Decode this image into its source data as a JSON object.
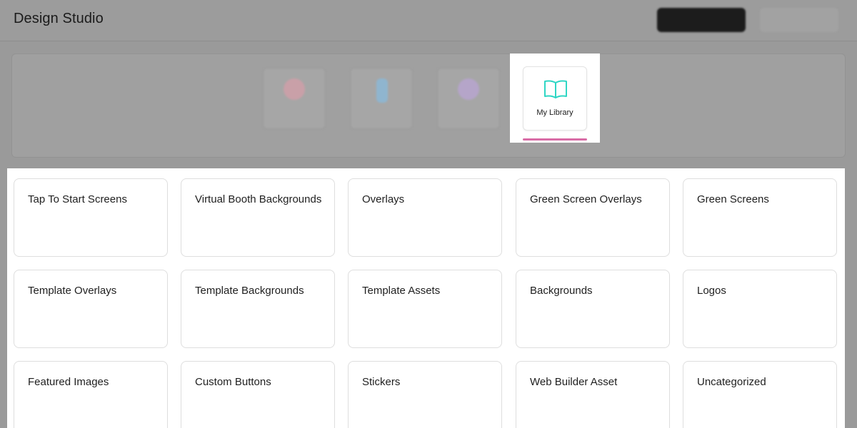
{
  "app": {
    "title": "Design Studio"
  },
  "tabs": [
    {
      "label": "",
      "icon": "image-icon",
      "state": "dimmed"
    },
    {
      "label": "",
      "icon": "bottle-icon",
      "state": "dimmed"
    },
    {
      "label": "",
      "icon": "sticker-icon",
      "state": "dimmed"
    },
    {
      "label": "My Library",
      "icon": "book-open-icon",
      "state": "active"
    }
  ],
  "categories": [
    "Tap To Start Screens",
    "Virtual Booth Backgrounds",
    "Overlays",
    "Green Screen Overlays",
    "Green Screens",
    "Template Overlays",
    "Template Backgrounds",
    "Template Assets",
    "Backgrounds",
    "Logos",
    "Featured Images",
    "Custom Buttons",
    "Stickers",
    "Web Builder Asset",
    "Uncategorized"
  ],
  "colors": {
    "accent_underline": "#d96ba6",
    "icon_teal": "#2fd6c4",
    "overlay_dim": "#9a9a9a"
  }
}
